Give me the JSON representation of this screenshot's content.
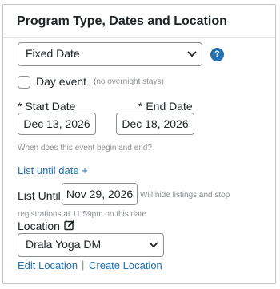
{
  "section": {
    "title": "Program Type, Dates and Location"
  },
  "program_type": {
    "selected": "Fixed Date",
    "help_glyph": "?"
  },
  "day_event": {
    "label": "Day event",
    "note": "(no overnight stays)",
    "checked": false
  },
  "dates": {
    "start_label": "* Start Date",
    "start_value": "Dec 13, 2026",
    "end_label": "* End Date",
    "end_value": "Dec 18, 2026",
    "hint": "When does this event begin and end?"
  },
  "list_until": {
    "add_link": "List until date +",
    "label": "List Until",
    "value": "Nov 29, 2026",
    "hint_line1": "Will hide listings and stop",
    "hint_line2": "registrations at 11:59pm on this date"
  },
  "location": {
    "label": "Location",
    "selected": "Drala Yoga DM",
    "edit_link": "Edit Location",
    "separator": "|",
    "create_link": "Create Location"
  },
  "colors": {
    "accent": "#2271b1",
    "border": "#8c8f94",
    "muted": "#8c8f94"
  }
}
